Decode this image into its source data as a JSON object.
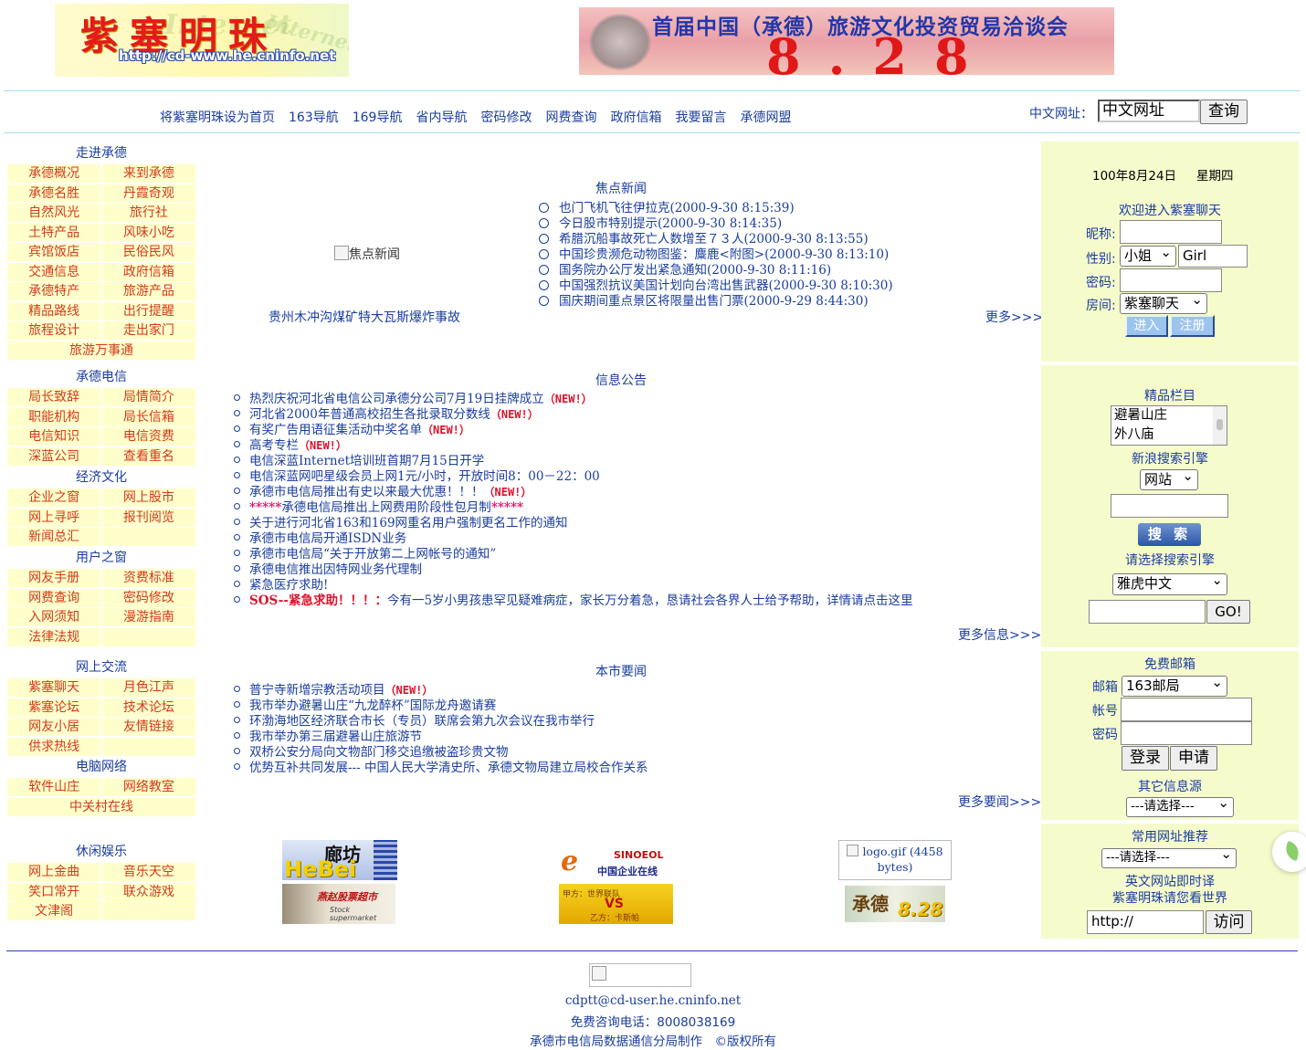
{
  "header": {
    "logo_title": "紫塞明珠",
    "logo_url": "http://cd-www.he.cninfo.net",
    "logo_watermark": "Internet",
    "banner_title": "首届中国（承德）旅游文化投资贸易洽谈会",
    "banner_number": "8.28"
  },
  "nav": {
    "items": [
      "将紫塞明珠设为首页",
      "163导航",
      "169导航",
      "省内导航",
      "密码修改",
      "网费查询",
      "政府信箱",
      "我要留言",
      "承德网盟"
    ],
    "chinese_url_label": "中文网址：",
    "chinese_url_value": "中文网址",
    "query_button": "查询"
  },
  "left_menu": {
    "sections": [
      {
        "title": "走进承德",
        "rows": [
          [
            "承德概况",
            "来到承德"
          ],
          [
            "承德名胜",
            "丹霞奇观"
          ],
          [
            "自然风光",
            "旅行社"
          ],
          [
            "土特产品",
            "风味小吃"
          ],
          [
            "宾馆饭店",
            "民俗民风"
          ],
          [
            "交通信息",
            "政府信箱"
          ],
          [
            "承德特产",
            "旅游产品"
          ],
          [
            "精品路线",
            "出行提醒"
          ],
          [
            "旅程设计",
            "走出家门"
          ],
          [
            "旅游万事通"
          ]
        ]
      },
      {
        "title": "承德电信",
        "rows": [
          [
            "局长致辞",
            "局情简介"
          ],
          [
            "职能机构",
            "局长信箱"
          ],
          [
            "电信知识",
            "电信资费"
          ],
          [
            "深蓝公司",
            "查看重名"
          ]
        ]
      },
      {
        "title": "经济文化",
        "rows": [
          [
            "企业之窗",
            "网上股市"
          ],
          [
            "网上寻呼",
            "报刊阅览"
          ],
          [
            "新闻总汇",
            ""
          ]
        ]
      },
      {
        "title": "用户之窗",
        "rows": [
          [
            "网友手册",
            "资费标准"
          ],
          [
            "网费查询",
            "密码修改"
          ],
          [
            "入网须知",
            "漫游指南"
          ],
          [
            "法律法规",
            ""
          ]
        ]
      },
      {
        "title": "网上交流",
        "rows": [
          [
            "紫塞聊天",
            "月色江声"
          ],
          [
            "紫塞论坛",
            "技术论坛"
          ],
          [
            "网友小居",
            "友情链接"
          ],
          [
            "供求热线",
            ""
          ]
        ]
      },
      {
        "title": "电脑网络",
        "rows": [
          [
            "软件山庄",
            "网络教室"
          ],
          [
            "中关村在线"
          ]
        ]
      },
      {
        "title": "休闲娱乐",
        "rows": [
          [
            "网上金曲",
            "音乐天空"
          ],
          [
            "笑口常开",
            "联众游戏"
          ],
          [
            "文津阁",
            ""
          ]
        ]
      }
    ]
  },
  "focus_news": {
    "title": "焦点新闻",
    "image_alt": "焦点新闻",
    "image_caption": "贵州木冲沟煤矿特大瓦斯爆炸事故",
    "items": [
      "也门飞机飞往伊拉克(2000-9-30 8:15:39)",
      "今日股市特别提示(2000-9-30 8:14:35)",
      "希腊沉船事故死亡人数增至７３人(2000-9-30 8:13:55)",
      "中国珍贵濒危动物图鉴：麋鹿<附图>(2000-9-30 8:13:10)",
      "国务院办公厅发出紧急通知(2000-9-30 8:11:16)",
      "中国强烈抗议美国计划向台湾出售武器(2000-9-30 8:10:30)",
      "国庆期间重点景区将限量出售门票(2000-9-29 8:44:30)"
    ],
    "more": "更多>>>"
  },
  "info": {
    "title": "信息公告",
    "new_tag": "（NEW!）",
    "items": [
      {
        "text": "热烈庆祝河北省电信公司承德分公司7月19日挂牌成立",
        "new": true
      },
      {
        "text": "河北省2000年普通高校招生各批录取分数线",
        "new": true
      },
      {
        "text": "有奖广告用语征集活动中奖名单",
        "new": true
      },
      {
        "text": "高考专栏",
        "new": true
      },
      {
        "text": "电信深蓝Internet培训班首期7月15日开学",
        "new": false
      },
      {
        "text": "电信深蓝网吧星级会员上网1元/小时，开放时间8：00－22：00",
        "new": false
      },
      {
        "text": "承德市电信局推出有史以来最大优惠！！！",
        "new": true
      },
      {
        "text": "承德电信局推出上网费用阶段性包月制",
        "stars": "*****",
        "new": false
      },
      {
        "text": "关于进行河北省163和169网重名用户强制更名工作的通知",
        "new": false
      },
      {
        "text": "承德市电信局开通ISDN业务",
        "new": false
      },
      {
        "text": "承德市电信局“关于开放第二上网帐号的通知”",
        "new": false
      },
      {
        "text": "承德电信推出因特网业务代理制",
        "new": false
      },
      {
        "text": "紧急医疗求助!",
        "new": false
      }
    ],
    "sos_prefix": "SOS--紧急求助！！！：",
    "sos_text": "今有一5岁小男孩患罕见疑难病症，家长万分着急，恳请社会各界人士给予帮助，详情请点击这里",
    "more": "更多信息>>>"
  },
  "city_news": {
    "title": "本市要闻",
    "items": [
      {
        "text": "普宁寺新增宗教活动项目",
        "new": true
      },
      {
        "text": "我市举办避暑山庄“九龙醉杯”国际龙舟邀请赛",
        "new": false
      },
      {
        "text": "环渤海地区经济联合市长（专员）联席会第九次会议在我市举行",
        "new": false
      },
      {
        "text": "我市举办第三届避暑山庄旅游节",
        "new": false
      },
      {
        "text": "双桥公安分局向文物部门移交追缴被盗珍贵文物",
        "new": false
      },
      {
        "text": "优势互补共同发展--- 中国人民大学清史所、承德文物局建立局校合作关系",
        "new": false
      }
    ],
    "more": "更多要闻>>>"
  },
  "ads": {
    "hebei_a": "廊坊",
    "hebei_b": "HeBei",
    "stock": "燕赵股票超市",
    "stock_en": "Stock supermarket",
    "sinoeol": "SINOEOL",
    "sinoeol_cn": "中国企业在线",
    "vs_left": "甲方：世界联队",
    "vs_mid": "VS",
    "vs_right": "乙方：卡斯帕",
    "logo_alt": "logo.gif (4458 bytes)",
    "chengde_a": "承德",
    "chengde_b": "8.28"
  },
  "chat": {
    "date": "100年8月24日",
    "weekday": "星期四",
    "welcome": "欢迎进入紫塞聊天",
    "nickname_label": "昵称:",
    "gender_label": "性别:",
    "gender_value": "小姐",
    "gender_text": "Girl",
    "password_label": "密码:",
    "room_label": "房间:",
    "room_value": "紫塞聊天",
    "enter_button": "进入",
    "register_button": "注册"
  },
  "search": {
    "featured_title": "精品栏目",
    "featured_items": [
      "避暑山庄",
      "外八庙"
    ],
    "sina_title": "新浪搜索引擎",
    "sina_select": "网站",
    "search_button": "搜 索",
    "engine_title": "请选择搜索引擎",
    "engine_select": "雅虎中文",
    "go_button": "GO!"
  },
  "mail": {
    "title": "免费邮箱",
    "mailbox_label": "邮箱",
    "mailbox_value": "163邮局",
    "account_label": "帐号",
    "password_label": "密码",
    "login_button": "登录",
    "apply_button": "申请",
    "other_title": "其它信息源",
    "other_select": "---请选择---"
  },
  "links": {
    "title": "常用网址推荐",
    "select": "---请选择---",
    "translate_line1": "英文网站即时译",
    "translate_line2": "紫塞明珠请您看世界",
    "url_value": "http://",
    "visit_button": "访问"
  },
  "footer": {
    "email": "cdptt@cd-user.he.cninfo.net",
    "phone": "免费咨询电话：8008038169",
    "copyright": "承德市电信局数据通信分局制作　©版权所有"
  },
  "colors": {
    "link": "#1a3d9e",
    "menu_item": "#d23b1a",
    "menu_bg": "#ffffcc",
    "panel_bg": "#f6fbcc",
    "new_tag": "#e0102a",
    "divider": "#9edfe8"
  }
}
